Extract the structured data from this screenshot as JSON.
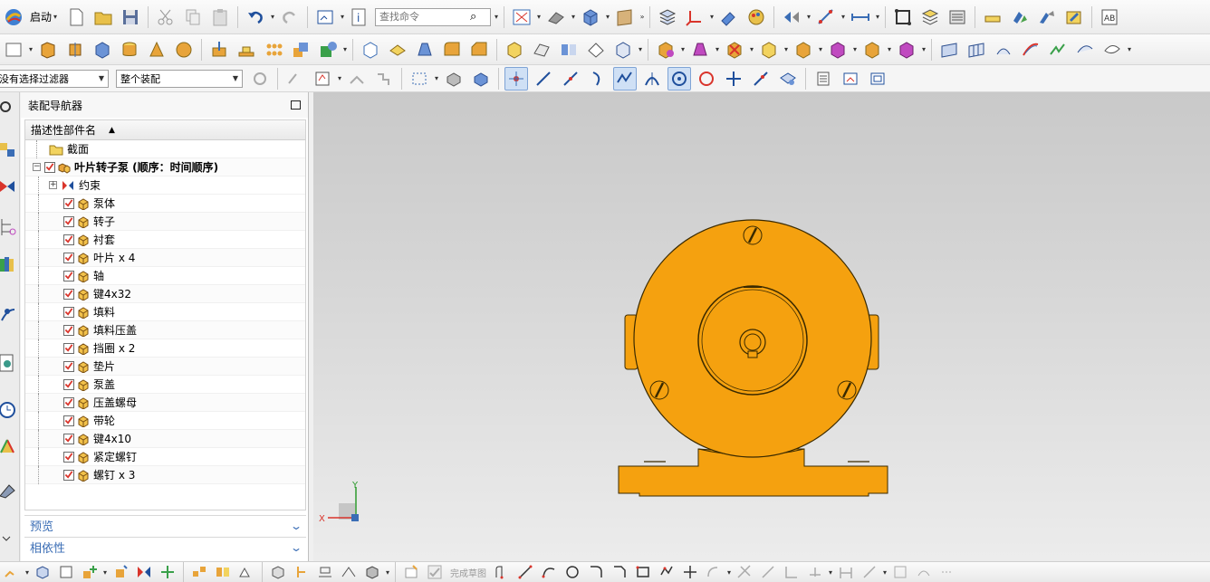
{
  "toolbar": {
    "start_label": "启动",
    "find_placeholder": "查找命令",
    "filter_select": "没有选择过滤器",
    "scope_select": "整个装配"
  },
  "navigator": {
    "title": "装配导航器",
    "column_header": "描述性部件名",
    "section_item": "截面",
    "root": "叶片转子泵 (顺序：时间顺序)",
    "constraints": "约束",
    "parts": [
      "泵体",
      "转子",
      "衬套",
      "叶片 x 4",
      "轴",
      "键4x32",
      "填料",
      "填料压盖",
      "挡圈 x 2",
      "垫片",
      "泵盖",
      "压盖螺母",
      "带轮",
      "键4x10",
      "紧定螺钉",
      "螺钉 x 3"
    ],
    "preview_label": "预览",
    "dependency_label": "相依性"
  },
  "bottom_toolbar": {
    "finish_sketch_label": "完成草图"
  },
  "viewport": {
    "triad_x": "X",
    "triad_y": "Y",
    "model_color": "#F5A10F"
  }
}
